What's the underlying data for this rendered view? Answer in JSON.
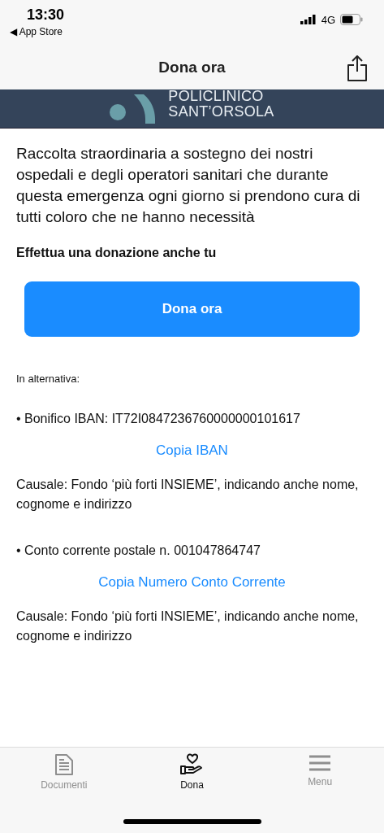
{
  "status_bar": {
    "time": "13:30",
    "back_app": "◀ App Store",
    "network": "4G"
  },
  "nav": {
    "title": "Dona ora"
  },
  "banner": {
    "line_1": "POLICLINICO",
    "line_2": "SANT’ORSOLA"
  },
  "intro": "Raccolta straordinaria a sostegno dei nostri ospedali e degli operatori sanitari che durante questa emergenza ogni giorno si prendono cura di tutti coloro che ne hanno necessità",
  "call_to_action": "Effettua una donazione anche tu",
  "donate_button": "Dona ora",
  "alternative_label": "In alternativa:",
  "methods": [
    {
      "detail": "• Bonifico IBAN: IT72I0847236760000000101617",
      "copy_link": "Copia IBAN",
      "reason": "Causale: Fondo ‘più forti INSIEME’, indicando anche nome, cognome e indirizzo"
    },
    {
      "detail": "• Conto corrente postale n. 001047864747",
      "copy_link": "Copia Numero Conto Corrente",
      "reason": "Causale: Fondo ‘più forti INSIEME’, indicando anche nome, cognome e indirizzo"
    }
  ],
  "tab_bar": [
    {
      "kind": "document",
      "label": "Documenti",
      "selected": false
    },
    {
      "kind": "donate",
      "label": "Dona",
      "selected": true
    },
    {
      "kind": "menu",
      "label": "Menu",
      "selected": false
    }
  ]
}
